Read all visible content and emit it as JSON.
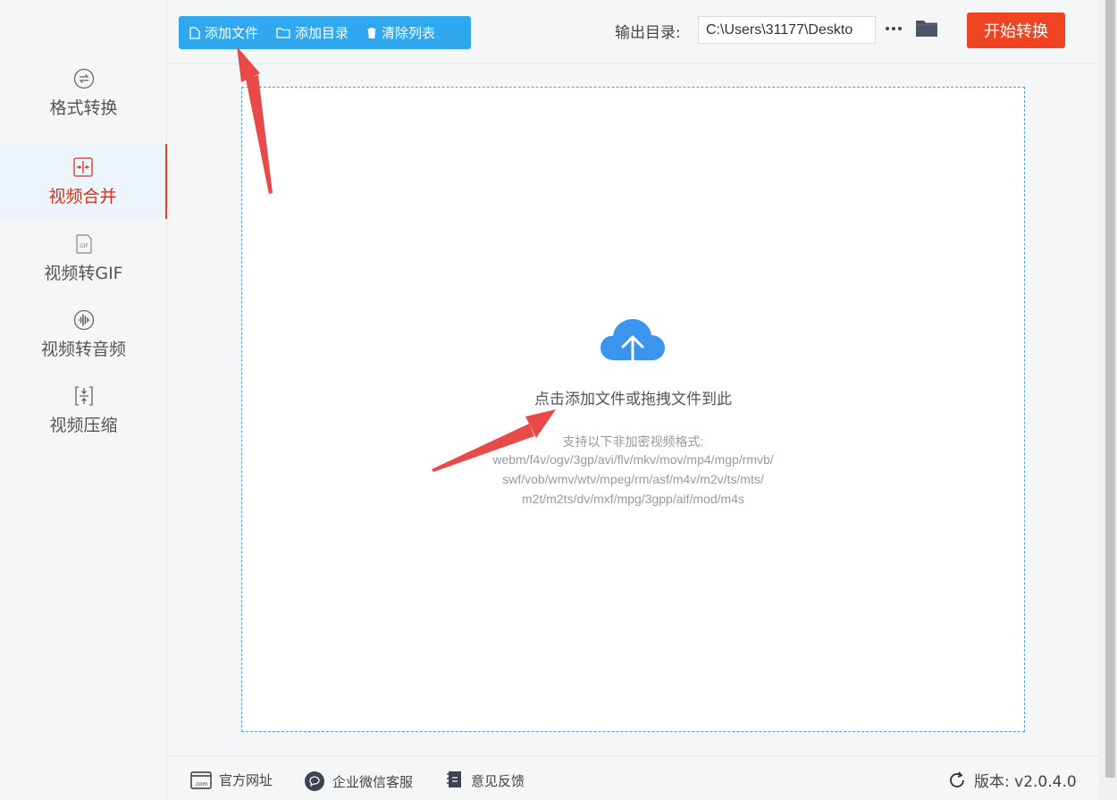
{
  "sidebar": {
    "items": [
      {
        "label": "格式转换",
        "icon": "format-convert-icon",
        "active": false
      },
      {
        "label": "视频合并",
        "icon": "video-merge-icon",
        "active": true
      },
      {
        "label": "视频转GIF",
        "icon": "gif-icon",
        "active": false
      },
      {
        "label": "视频转音频",
        "icon": "audio-wave-icon",
        "active": false
      },
      {
        "label": "视频压缩",
        "icon": "compress-icon",
        "active": false
      }
    ]
  },
  "toolbar": {
    "add_file": "添加文件",
    "add_dir": "添加目录",
    "clear_list": "清除列表",
    "output_label": "输出目录:",
    "output_path": "C:\\Users\\31177\\Deskto",
    "more": "···",
    "start": "开始转换"
  },
  "drop": {
    "title": "点击添加文件或拖拽文件到此",
    "formats_head": "支持以下非加密视频格式:",
    "formats": [
      "webm/f4v/ogv/3gp/avi/flv/mkv/mov/mp4/mgp/rmvb/",
      "swf/vob/wmv/wtv/mpeg/rm/asf/m4v/m2v/ts/mts/",
      "m2t/m2ts/dv/mxf/mpg/3gpp/aif/mod/m4s"
    ]
  },
  "footer": {
    "website": "官方网址",
    "wechat": "企业微信客服",
    "feedback": "意见反馈",
    "version": "版本:  v2.0.4.0"
  },
  "colors": {
    "accent_blue": "#2fa8ef",
    "start_red": "#ef4422",
    "active_red": "#d0331f",
    "arrow_red": "#e84a4a"
  }
}
